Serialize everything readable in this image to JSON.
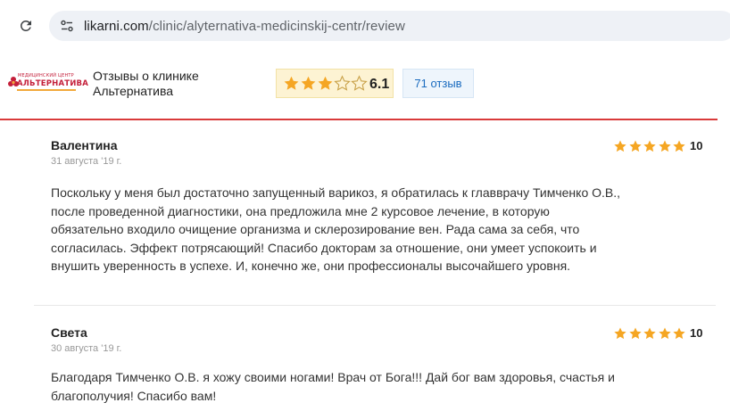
{
  "browser": {
    "url_host": "likarni.com",
    "url_path": "/clinic/alyternativa-medicinskij-centr/review"
  },
  "clinic": {
    "logo_line1": "МЕДИЦИНСКИЙ ЦЕНТР",
    "logo_line2": "АЛЬТЕРНАТИВА",
    "title": "Отзывы о клинике Альтернатива",
    "rating_value": "6.1",
    "rating_stars": 3,
    "rating_max": 5,
    "reviews_count": "71 отзыв"
  },
  "colors": {
    "accent_red": "#d93a3a",
    "star_gold": "#f5a623",
    "link_blue": "#1a6bbf"
  },
  "reviews": [
    {
      "author": "Валентина",
      "date": "31 августа '19 г.",
      "stars": 5,
      "score": "10",
      "text": "Поскольку у меня был достаточно запущенный варикоз, я обратилась к главврачу Тимченко О.В., после проведенной диагностики, она предложила мне 2 курсовое лечение, в которую обязательно входило очищение организма и склерозирование вен. Рада сама за себя, что согласилась. Эффект потрясающий! Спасибо докторам за отношение, они умеет успокоить и внушить уверенность в успехе. И, конечно же, они профессионалы высочайшего уровня."
    },
    {
      "author": "Света",
      "date": "30 августа '19 г.",
      "stars": 5,
      "score": "10",
      "text": "Благодаря Тимченко О.В. я хожу своими ногами! Врач от Бога!!! Дай бог вам здоровья, счастья и благополучия! Спасибо вам!"
    }
  ]
}
